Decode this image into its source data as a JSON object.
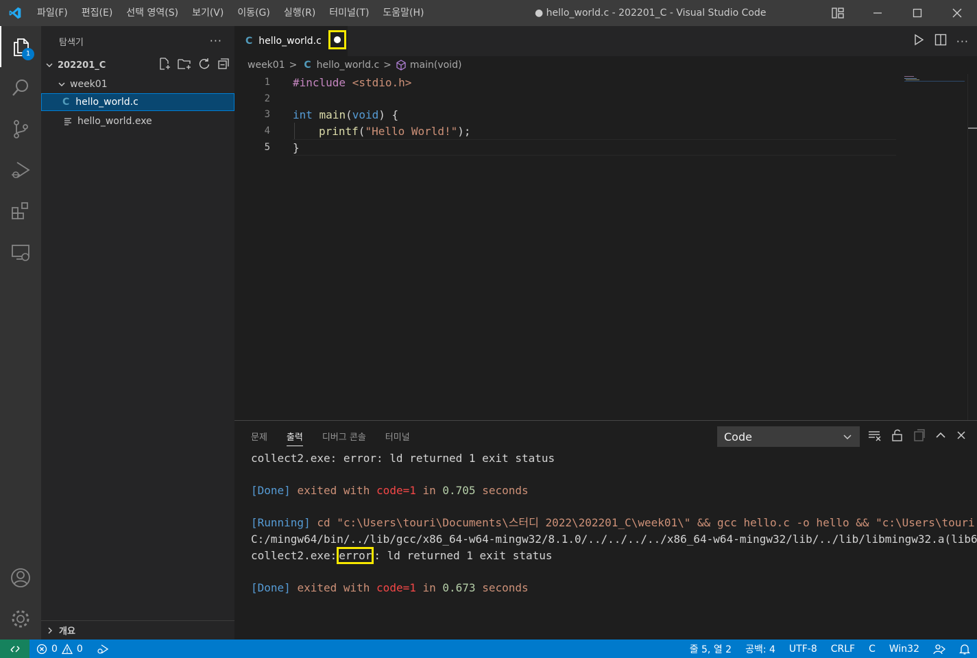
{
  "titlebar": {
    "menu": [
      "파일(F)",
      "편집(E)",
      "선택 영역(S)",
      "보기(V)",
      "이동(G)",
      "실행(R)",
      "터미널(T)",
      "도움말(H)"
    ],
    "window_title": "● hello_world.c - 202201_C - Visual Studio Code"
  },
  "activitybar": {
    "items": [
      "explorer-icon",
      "search-icon",
      "source-control-icon",
      "run-debug-icon",
      "extensions-icon",
      "remote-explorer-icon",
      "account-icon",
      "settings-gear-icon"
    ],
    "explorer_badge": "1"
  },
  "sidebar": {
    "title": "탐색기",
    "more": "···",
    "root_folder": "202201_C",
    "subfolder": "week01",
    "files": [
      "hello_world.c",
      "hello_world.exe"
    ],
    "outline_label": "개요"
  },
  "editor": {
    "tab_label": "hello_world.c",
    "breadcrumb": [
      "week01",
      "hello_world.c",
      "main(void)"
    ],
    "line_numbers": [
      "1",
      "2",
      "3",
      "4",
      "5"
    ],
    "code": {
      "l1_pre": "#include",
      "l1_inc": "<stdio.h>",
      "l3_type": "int",
      "l3_fn": "main",
      "l3_open": "(",
      "l3_void": "void",
      "l3_close": ") {",
      "l4_fn": "printf",
      "l4_open": "(",
      "l4_str": "\"Hello World!\"",
      "l4_close": ");",
      "l5": "}"
    }
  },
  "panel": {
    "tabs": [
      "문제",
      "출력",
      "디버그 콘솔",
      "터미널"
    ],
    "output_channel": "Code",
    "output": {
      "l1": "collect2.exe: error: ld returned 1 exit status",
      "done_tag": "[Done]",
      "exited_with": "exited with",
      "code1": "code=1",
      "in": "in",
      "t1": "0.705",
      "seconds": "seconds",
      "running_tag": "[Running]",
      "running_cmd": "cd \"c:\\Users\\touri\\Documents\\스터디 2022\\202201_C\\week01\\\" && gcc hello.c -o hello && \"c:\\Users\\touri",
      "path_line": "C:/mingw64/bin/../lib/gcc/x86_64-w64-mingw32/8.1.0/../../../../x86_64-w64-mingw32/lib/../lib/libmingw32.a(lib6",
      "collect_prefix": "collect2.exe:",
      "error_word": "error",
      "collect_suffix": ": ld returned 1 exit status",
      "t2": "0.673"
    }
  },
  "statusbar": {
    "errors": "0",
    "warnings": "0",
    "position": "줄 5, 열 2",
    "spaces": "공백: 4",
    "encoding": "UTF-8",
    "eol": "CRLF",
    "language": "C",
    "platform": "Win32"
  },
  "colors": {
    "accent": "#007acc",
    "highlight": "#f7e700",
    "selection": "#094771"
  }
}
